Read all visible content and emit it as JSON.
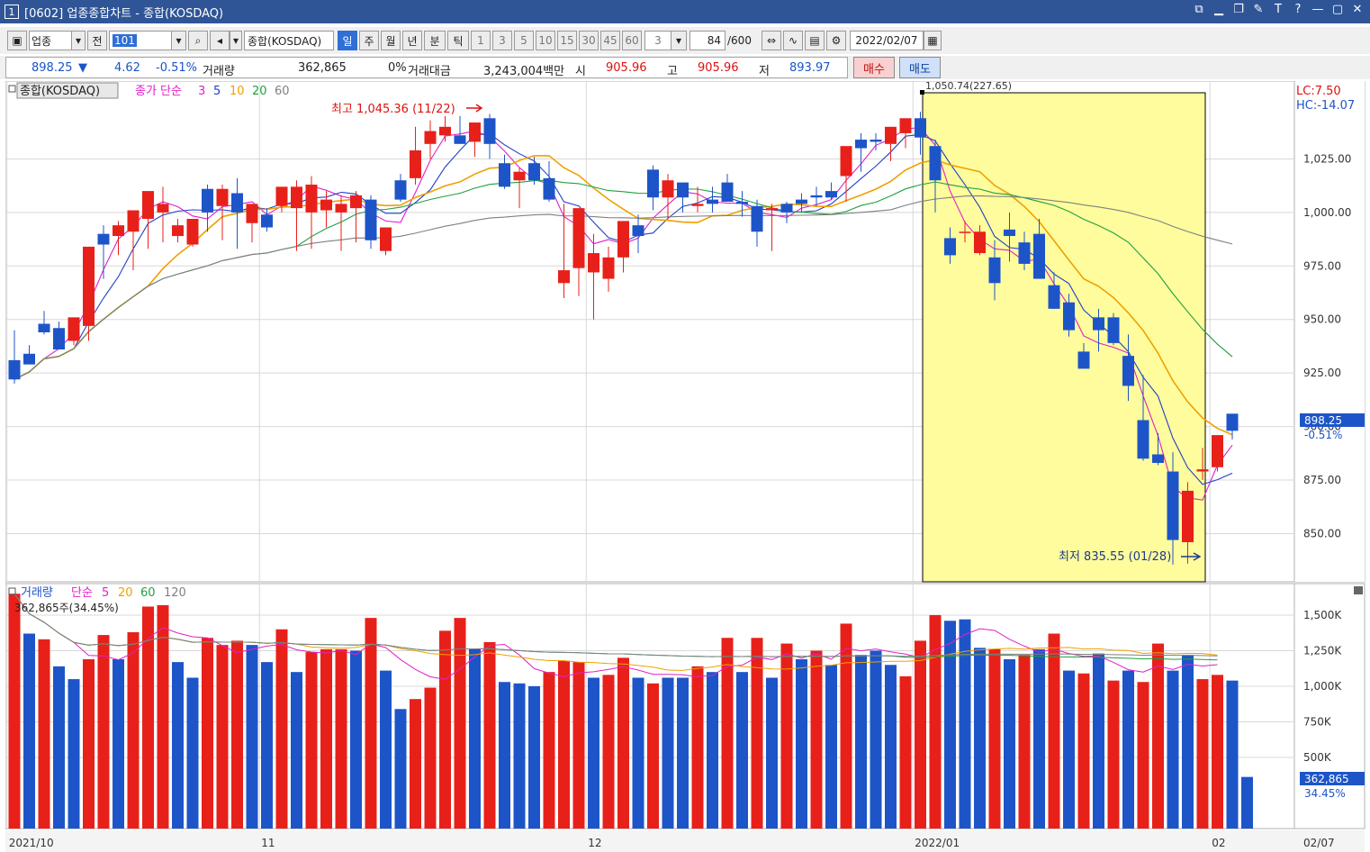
{
  "window": {
    "number": "1",
    "title": "[0602] 업종종합차트 - 종합(KOSDAQ)",
    "icons": [
      "window-restore-icon",
      "minimize-dash-icon",
      "copy-icon",
      "paint-icon",
      "text-icon",
      "help-icon",
      "minimize-icon",
      "maximize-icon",
      "close-icon"
    ]
  },
  "toolbar": {
    "category": "업종",
    "prev_label": "전",
    "code": "101",
    "index_name": "종합(KOSDAQ)",
    "periods": [
      "일",
      "주",
      "월",
      "년",
      "분",
      "틱"
    ],
    "active_period": "일",
    "intervals": [
      "1",
      "3",
      "5",
      "10",
      "15",
      "30",
      "45",
      "60"
    ],
    "interval_value": "3",
    "count": "84",
    "count_max": "/600",
    "date": "2022/02/07"
  },
  "quote": {
    "price": "898.25",
    "arrow": "▼",
    "change": "4.62",
    "change_pct": "-0.51%",
    "volume_label": "거래량",
    "volume": "362,865",
    "volume_pct": "0%",
    "amount_label": "거래대금",
    "amount": "3,243,004백만",
    "open_label": "시",
    "open": "905.96",
    "high_label": "고",
    "high": "905.96",
    "low_label": "저",
    "low": "893.97",
    "buy_label": "매수",
    "sell_label": "매도"
  },
  "colors": {
    "up": "#e8201a",
    "down": "#1d55c8",
    "ma3": "#e020c8",
    "ma5": "#2040c8",
    "ma10": "#f0a000",
    "ma20": "#20a040",
    "ma60": "#808080",
    "highlight": "#fefc9c",
    "title_bar": "#2f5597"
  },
  "chart_data": [
    {
      "type": "candlestick",
      "legend": {
        "name": "종합(KOSDAQ)",
        "series_label": "종가 단순",
        "periods": [
          "3",
          "5",
          "10",
          "20",
          "60"
        ]
      },
      "ylim": [
        830,
        1058
      ],
      "y_ticks": [
        "1,025.00",
        "1,000.00",
        "975.00",
        "950.00",
        "925.00",
        "900.00",
        "875.00",
        "850.00"
      ],
      "y_tick_values": [
        1025,
        1000,
        975,
        950,
        925,
        900,
        875,
        850
      ],
      "x_labels": [
        "2021/10",
        "11",
        "12",
        "2022/01",
        "02",
        "02/07"
      ],
      "x_label_index": [
        0,
        17,
        39,
        61,
        81
      ],
      "last_price_label": "898.25",
      "last_pct_label": "-0.51%",
      "lc_label": "LC:7.50",
      "hc_label": "HC:-14.07",
      "high_annotation": "최고 1,045.36 (11/22)",
      "low_annotation": "최저 835.55 (01/28)",
      "range_annotation": "1,050.74(227.65)",
      "candles": [
        [
          931,
          945,
          920,
          922
        ],
        [
          934,
          938,
          931,
          929
        ],
        [
          948,
          954,
          943,
          944
        ],
        [
          946,
          949,
          936,
          936
        ],
        [
          940,
          945,
          938,
          951
        ],
        [
          947,
          953,
          940,
          984
        ],
        [
          990,
          994,
          969,
          985
        ],
        [
          989,
          996,
          980,
          994
        ],
        [
          991,
          1001,
          973,
          1001
        ],
        [
          997,
          1009,
          983,
          1010
        ],
        [
          1000,
          1012,
          986,
          1004
        ],
        [
          989,
          997,
          986,
          994
        ],
        [
          985,
          994,
          984,
          997
        ],
        [
          1011,
          1013,
          991,
          1000
        ],
        [
          1003,
          1013,
          987,
          1011
        ],
        [
          1009,
          1016,
          983,
          1000
        ],
        [
          995,
          1004,
          986,
          1004
        ],
        [
          999,
          1002,
          991,
          993
        ],
        [
          1003,
          1011,
          1000,
          1012
        ],
        [
          1002,
          1015,
          982,
          1012
        ],
        [
          1000,
          1017,
          983,
          1013
        ],
        [
          1001,
          1010,
          993,
          1006
        ],
        [
          1000,
          1008,
          982,
          1004
        ],
        [
          1002,
          1010,
          986,
          1008
        ],
        [
          1006,
          1008,
          983,
          987
        ],
        [
          982,
          988,
          980,
          993
        ],
        [
          1015,
          1018,
          1005,
          1006
        ],
        [
          1016,
          1040,
          1013,
          1029
        ],
        [
          1032,
          1043,
          1025,
          1038
        ],
        [
          1036,
          1045,
          1033,
          1040
        ],
        [
          1036,
          1045,
          1032,
          1032
        ],
        [
          1033,
          1041,
          1026,
          1042
        ],
        [
          1044,
          1046,
          1025,
          1032
        ],
        [
          1023,
          1027,
          1011,
          1012
        ],
        [
          1015,
          1021,
          1002,
          1019
        ],
        [
          1023,
          1026,
          1013,
          1015
        ],
        [
          1016,
          1024,
          1005,
          1006
        ],
        [
          967,
          1004,
          960,
          973
        ],
        [
          974,
          983,
          961,
          1002
        ],
        [
          972,
          990,
          950,
          981
        ],
        [
          969,
          984,
          963,
          979
        ],
        [
          979,
          986,
          972,
          996
        ],
        [
          994,
          999,
          981,
          989
        ],
        [
          1020,
          1022,
          1001,
          1007
        ],
        [
          1007,
          1018,
          997,
          1015
        ],
        [
          1014,
          1011,
          1000,
          1007
        ],
        [
          1003,
          1012,
          1000,
          1004
        ],
        [
          1006,
          1012,
          1000,
          1004
        ],
        [
          1014,
          1018,
          1006,
          1005
        ],
        [
          1005,
          1010,
          998,
          1004
        ],
        [
          1003,
          1006,
          984,
          991
        ],
        [
          1001,
          1004,
          982,
          1002
        ],
        [
          1004,
          1005,
          995,
          1000
        ],
        [
          1006,
          1009,
          1000,
          1004
        ],
        [
          1008,
          1012,
          1003,
          1007
        ],
        [
          1010,
          1014,
          1006,
          1007
        ],
        [
          1017,
          1022,
          1005,
          1031
        ],
        [
          1034,
          1037,
          1019,
          1030
        ],
        [
          1034,
          1037,
          1029,
          1033
        ],
        [
          1032,
          1037,
          1024,
          1040
        ],
        [
          1037,
          1043,
          1030,
          1044
        ],
        [
          1044,
          1047,
          1027,
          1035
        ],
        [
          1031,
          1034,
          1000,
          1015
        ],
        [
          988,
          993,
          976,
          980
        ],
        [
          991,
          996,
          986,
          991
        ],
        [
          981,
          994,
          980,
          991
        ],
        [
          979,
          987,
          959,
          967
        ],
        [
          992,
          1000,
          977,
          989
        ],
        [
          986,
          991,
          973,
          976
        ],
        [
          990,
          997,
          978,
          969
        ],
        [
          966,
          972,
          955,
          955
        ],
        [
          958,
          962,
          942,
          945
        ],
        [
          935,
          939,
          928,
          927
        ],
        [
          951,
          955,
          935,
          945
        ],
        [
          951,
          953,
          938,
          939
        ],
        [
          933,
          943,
          912,
          919
        ],
        [
          903,
          924,
          884,
          885
        ],
        [
          887,
          897,
          882,
          883
        ],
        [
          879,
          888,
          835.5,
          847
        ],
        [
          846,
          874,
          836,
          870
        ],
        [
          879,
          890,
          875,
          880
        ],
        [
          881,
          894,
          879,
          896
        ],
        [
          906,
          906,
          894,
          898
        ]
      ]
    },
    {
      "type": "bar",
      "legend": {
        "name": "거래량",
        "series_label": "단순",
        "periods": [
          "5",
          "20",
          "60",
          "120"
        ]
      },
      "ylim": [
        0,
        1620000
      ],
      "y_ticks": [
        "1,500K",
        "1,250K",
        "1,000K",
        "750K",
        "500K"
      ],
      "y_tick_values": [
        1500000,
        1250000,
        1000000,
        750000,
        500000
      ],
      "top_annotation": "362,865주(34.45%)",
      "last_value_label": "362,865",
      "last_pct_label": "34.45%",
      "values": [
        1650000,
        1370000,
        1330000,
        1140000,
        1050000,
        1190000,
        1360000,
        1190000,
        1380000,
        1560000,
        1570000,
        1170000,
        1060000,
        1340000,
        1290000,
        1320000,
        1290000,
        1170000,
        1400000,
        1100000,
        1240000,
        1260000,
        1260000,
        1250000,
        1480000,
        1110000,
        840000,
        910000,
        990000,
        1390000,
        1480000,
        1260000,
        1310000,
        1030000,
        1020000,
        1000000,
        1100000,
        1180000,
        1170000,
        1060000,
        1080000,
        1200000,
        1060000,
        1020000,
        1060000,
        1060000,
        1140000,
        1100000,
        1340000,
        1100000,
        1340000,
        1060000,
        1300000,
        1190000,
        1250000,
        1150000,
        1440000,
        1220000,
        1250000,
        1150000,
        1070000,
        1320000,
        1500000,
        1460000,
        1470000,
        1270000,
        1260000,
        1190000,
        1220000,
        1260000,
        1370000,
        1110000,
        1090000,
        1230000,
        1040000,
        1110000,
        1030000,
        1300000,
        1110000,
        1220000,
        1050000,
        1080000,
        1040000,
        362865
      ],
      "up": [
        true,
        false,
        true,
        false,
        false,
        true,
        true,
        false,
        true,
        true,
        true,
        false,
        false,
        true,
        true,
        true,
        false,
        false,
        true,
        false,
        true,
        true,
        true,
        false,
        true,
        false,
        false,
        true,
        true,
        true,
        true,
        false,
        true,
        false,
        false,
        false,
        true,
        true,
        true,
        false,
        true,
        true,
        false,
        true,
        false,
        false,
        true,
        false,
        true,
        false,
        true,
        false,
        true,
        false,
        true,
        false,
        true,
        false,
        false,
        false,
        true,
        true,
        true,
        false,
        false,
        false,
        true,
        false,
        true,
        false,
        true,
        false,
        true,
        false,
        true,
        false,
        true,
        true,
        false,
        false,
        true,
        true,
        false,
        false
      ]
    }
  ]
}
